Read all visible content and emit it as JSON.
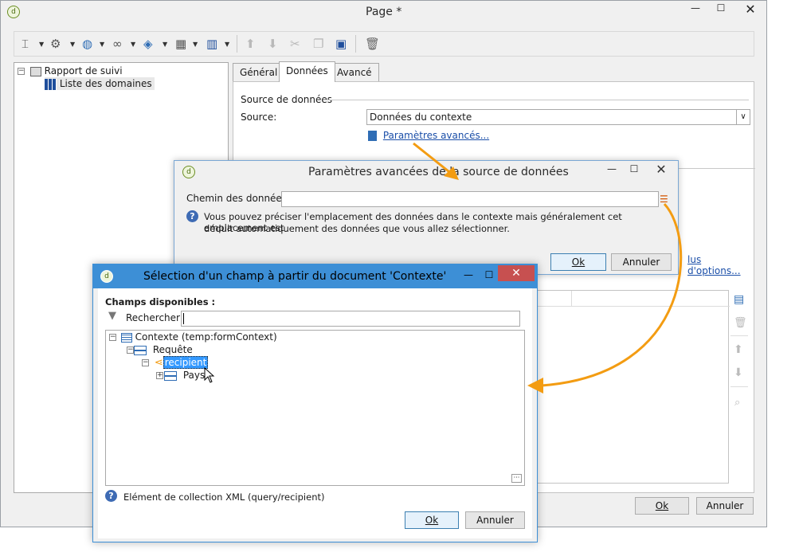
{
  "main": {
    "title": "Page *",
    "tree": {
      "root": "Rapport de suivi",
      "child": "Liste des domaines"
    },
    "tabs": [
      {
        "label": "Général"
      },
      {
        "label": "Données"
      },
      {
        "label": "Avancé"
      }
    ],
    "data_tab": {
      "group_label": "Source de données",
      "source_label": "Source:",
      "source_value": "Données du contexte",
      "advanced_link": "Paramètres avancés...",
      "more_options_link": "lus d'options..."
    },
    "ok_label": "Ok",
    "cancel_label": "Annuler"
  },
  "dialog_advanced": {
    "title": "Paramètres avancées de la source de données",
    "path_label": "Chemin des données:",
    "path_value": "",
    "help_line1": "Vous pouvez préciser l'emplacement des données dans le contexte mais généralement cet emplacement est",
    "help_line2": "déduit automatiquement des données que vous allez sélectionner.",
    "ok_label": "Ok",
    "cancel_label": "Annuler"
  },
  "dialog_select": {
    "title": "Sélection d'un champ à partir du document 'Contexte'",
    "fields_label": "Champs disponibles :",
    "search_label": "Rechercher:",
    "search_value": "",
    "tree": {
      "root": "Contexte (temp:formContext)",
      "query": "Requête",
      "recipient": "recipient",
      "country": "Pays"
    },
    "status": "Elément de collection XML (query/recipient)",
    "ok_label": "Ok",
    "cancel_label": "Annuler"
  },
  "colors": {
    "accent": "#3d8fd6",
    "selection": "#3399ff",
    "arrow": "#f39c12",
    "close": "#c75050"
  }
}
